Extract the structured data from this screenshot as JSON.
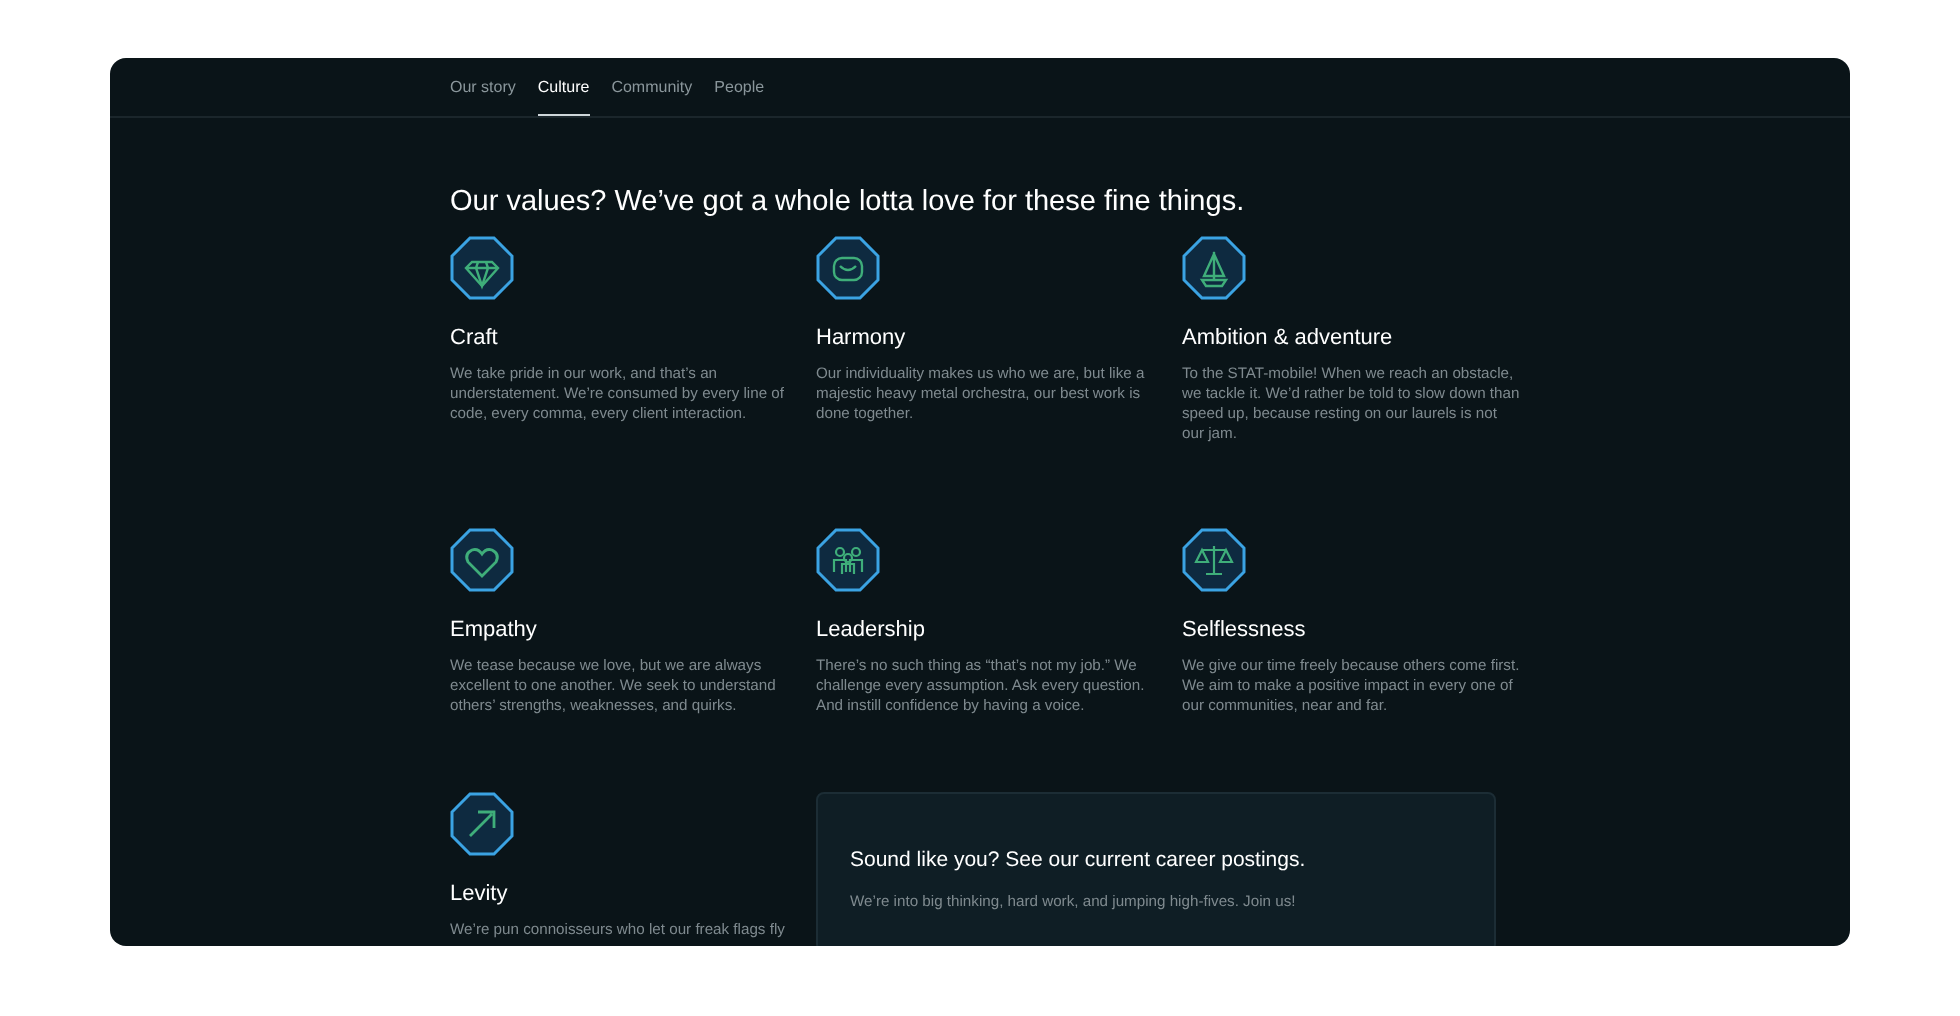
{
  "nav": [
    {
      "label": "Our story",
      "selected": false
    },
    {
      "label": "Culture",
      "selected": true
    },
    {
      "label": "Community",
      "selected": false
    },
    {
      "label": "People",
      "selected": false
    }
  ],
  "heading": "Our values? We’ve got a whole lotta love for these fine things.",
  "values": [
    {
      "title": "Craft",
      "text": "We take pride in our work, and that’s an understatement. We’re consumed by every line of code, every comma, every client interaction."
    },
    {
      "title": "Harmony",
      "text": "Our individuality makes us who we are, but like a majestic heavy metal orchestra, our best work is done together."
    },
    {
      "title": "Ambition & adventure",
      "text": "To the STAT-mobile! When we reach an obstacle, we tackle it. We’d rather be told to slow down than speed up, because resting on our laurels is not our jam."
    },
    {
      "title": "Empathy",
      "text": "We tease because we love, but we are always excellent to one another. We seek to understand others’ strengths, weaknesses, and quirks."
    },
    {
      "title": "Leadership",
      "text": "There’s no such thing as “that’s not my job.” We challenge every assumption. Ask every question. And instill confidence by having a voice."
    },
    {
      "title": "Selflessness",
      "text": "We give our time freely because others come first. We aim to make a positive impact in every one of our communities, near and far."
    },
    {
      "title": "Levity",
      "text": "We’re pun connoisseurs who let our freak flags fly"
    }
  ],
  "cta": {
    "title": "Sound like you? See our current career postings.",
    "text": "We’re into big thinking, hard work, and jumping high-fives. Join us!"
  }
}
